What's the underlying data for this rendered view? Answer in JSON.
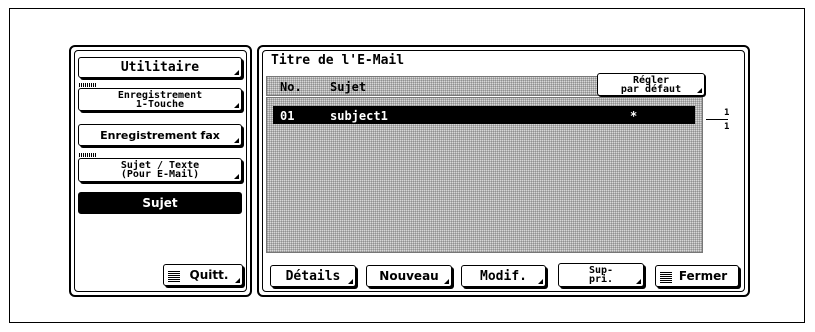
{
  "sidebar": {
    "items": [
      {
        "label": "Utilitaire"
      },
      {
        "label": "Enregistrement\n1-Touche"
      },
      {
        "label": "Enregistrement fax"
      },
      {
        "label": "Sujet / Texte\n(Pour E-Mail)"
      },
      {
        "label": "Sujet"
      }
    ],
    "quit_label": "Quitt."
  },
  "main": {
    "title": "Titre de l'E-Mail",
    "columns": {
      "no": "No.",
      "subject": "Sujet"
    },
    "default_button": "Régler\npar défaut",
    "rows": [
      {
        "no": "01",
        "subject": "subject1",
        "default_mark": "*"
      }
    ],
    "page": {
      "current": "1",
      "total": "1"
    }
  },
  "footer": {
    "details": "Détails",
    "new": "Nouveau",
    "modify": "Modif.",
    "delete": "Sup-\npri.",
    "close": "Fermer"
  }
}
